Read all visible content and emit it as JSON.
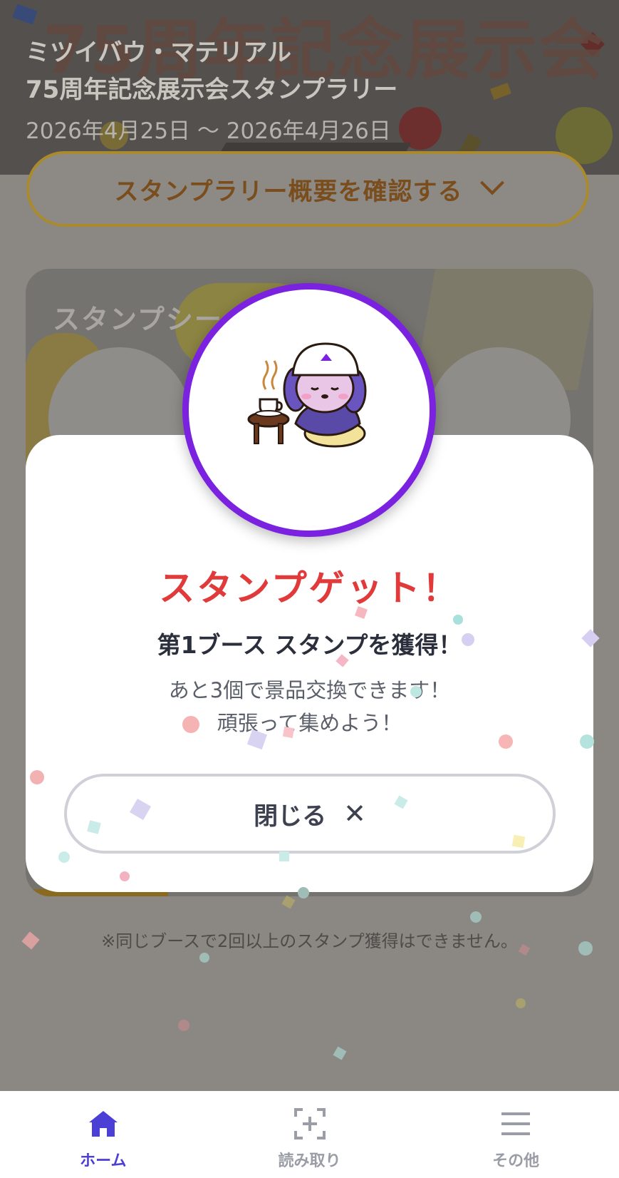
{
  "header": {
    "banner_text": "75周年記念展示会",
    "org": "ミツイバウ・マテリアル",
    "title": "75周年記念展示会スタンプラリー",
    "dates": "2026年4月25日 ～ 2026年4月26日"
  },
  "overview": {
    "label": "スタンプラリー概要を確認する",
    "icon": "chevron-down-icon"
  },
  "stamp_sheet": {
    "title": "スタンプシー"
  },
  "notice": "※同じブースで2回以上のスタンプ獲得はできません。",
  "modal": {
    "badge_icon": "mascot-coffee-stamp",
    "title": "スタンプゲット！",
    "subtitle": "第1ブース スタンプを獲得！",
    "message_line1": "あと3個で景品交換できます！",
    "message_line2": "頑張って集めよう！",
    "close_label": "閉じる",
    "close_icon": "close-icon",
    "accent_color": "#7b22e0",
    "title_color": "#e03a3a"
  },
  "nav": {
    "items": [
      {
        "label": "ホーム",
        "icon": "home-icon",
        "active": true,
        "color": "#4b3fd6"
      },
      {
        "label": "読み取り",
        "icon": "scan-icon",
        "active": false,
        "color": "#9a9ca6"
      },
      {
        "label": "その他",
        "icon": "menu-icon",
        "active": false,
        "color": "#9a9ca6"
      }
    ]
  }
}
